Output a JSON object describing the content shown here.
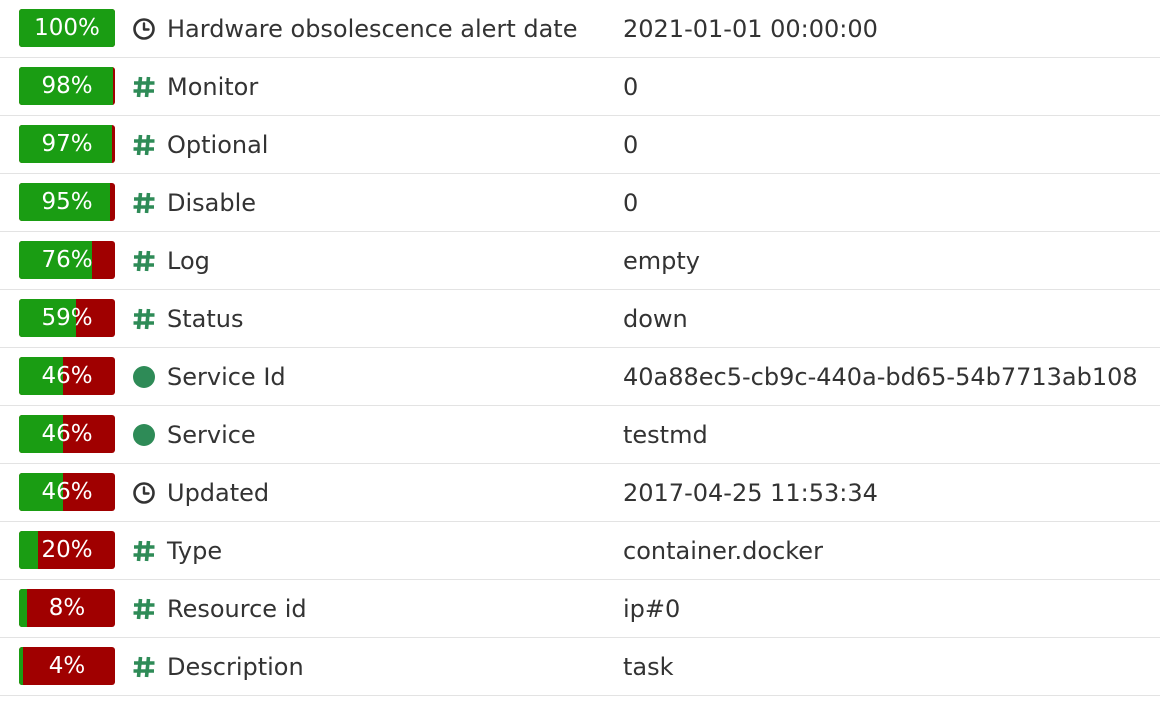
{
  "colors": {
    "bar_good": "#1a9d13",
    "bar_bad": "#a00000",
    "icon_hash": "#2e8b57",
    "icon_dot": "#2e8b57",
    "icon_clock": "#333333"
  },
  "rows": [
    {
      "percent": 100,
      "percent_label": "100%",
      "icon": "clock-icon",
      "name": "Hardware obsolescence alert date",
      "value": "2021-01-01 00:00:00"
    },
    {
      "percent": 98,
      "percent_label": "98%",
      "icon": "hash-icon",
      "name": "Monitor",
      "value": "0"
    },
    {
      "percent": 97,
      "percent_label": "97%",
      "icon": "hash-icon",
      "name": "Optional",
      "value": "0"
    },
    {
      "percent": 95,
      "percent_label": "95%",
      "icon": "hash-icon",
      "name": "Disable",
      "value": "0"
    },
    {
      "percent": 76,
      "percent_label": "76%",
      "icon": "hash-icon",
      "name": "Log",
      "value": "empty"
    },
    {
      "percent": 59,
      "percent_label": "59%",
      "icon": "hash-icon",
      "name": "Status",
      "value": "down"
    },
    {
      "percent": 46,
      "percent_label": "46%",
      "icon": "dot-icon",
      "name": "Service Id",
      "value": "40a88ec5-cb9c-440a-bd65-54b7713ab108"
    },
    {
      "percent": 46,
      "percent_label": "46%",
      "icon": "dot-icon",
      "name": "Service",
      "value": "testmd"
    },
    {
      "percent": 46,
      "percent_label": "46%",
      "icon": "clock-icon",
      "name": "Updated",
      "value": "2017-04-25 11:53:34"
    },
    {
      "percent": 20,
      "percent_label": "20%",
      "icon": "hash-icon",
      "name": "Type",
      "value": "container.docker"
    },
    {
      "percent": 8,
      "percent_label": "8%",
      "icon": "hash-icon",
      "name": "Resource id",
      "value": "ip#0"
    },
    {
      "percent": 4,
      "percent_label": "4%",
      "icon": "hash-icon",
      "name": "Description",
      "value": "task"
    }
  ]
}
